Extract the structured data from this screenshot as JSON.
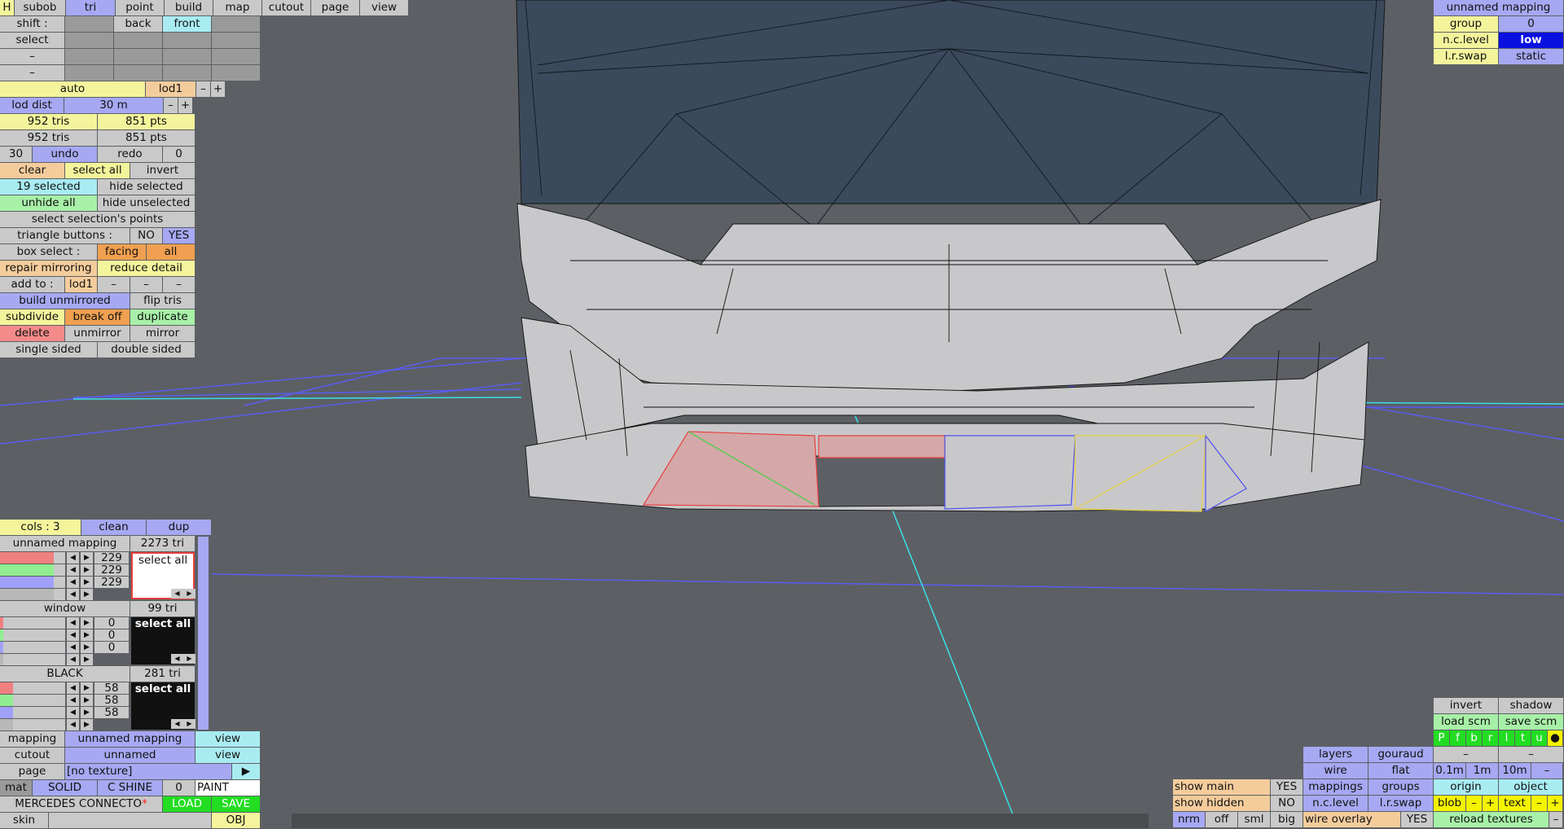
{
  "colors": {
    "bg_ground": "#5c6064",
    "bg_sky": "#5c6064",
    "grid_blue": "#5a5cf0",
    "axis_cyan": "#39e0e8",
    "glass": "#3a4a5c",
    "body": "#c8c8ca",
    "sel_red": "#e84040",
    "sel_green": "#40d040",
    "sel_yellow": "#e8d040",
    "sel_blue": "#5050f0"
  },
  "top_menu": {
    "h": "H",
    "items": [
      "subob",
      "tri",
      "point",
      "build",
      "map",
      "cutout",
      "page",
      "view"
    ]
  },
  "shift": {
    "label": "shift :",
    "back": "back",
    "front": "front"
  },
  "select": {
    "label": "select"
  },
  "dash_rows": [
    "–",
    "–"
  ],
  "auto": {
    "label": "auto",
    "lod": "lod1",
    "minus": "–",
    "plus": "+"
  },
  "lod_dist": {
    "label": "lod dist",
    "value": "30 m",
    "minus": "–",
    "plus": "+"
  },
  "counts": [
    {
      "tris": "952 tris",
      "pts": "851 pts"
    },
    {
      "tris": "952 tris",
      "pts": "851 pts"
    }
  ],
  "history": {
    "left": "30",
    "undo": "undo",
    "redo": "redo",
    "right": "0"
  },
  "selection": {
    "clear": "clear",
    "select_all": "select all",
    "invert": "invert",
    "selected": "19 selected",
    "hide_selected": "hide selected",
    "unhide_all": "unhide all",
    "hide_unselected": "hide unselected",
    "select_points": "select selection's points"
  },
  "triangle_buttons": {
    "label": "triangle buttons :",
    "no": "NO",
    "yes": "YES"
  },
  "box_select": {
    "label": "box select :",
    "facing": "facing",
    "all": "all"
  },
  "repair": {
    "repair": "repair mirroring",
    "reduce": "reduce detail"
  },
  "add_to": {
    "label": "add to :",
    "lod": "lod1",
    "d1": "–",
    "d2": "–",
    "d3": "–"
  },
  "build": {
    "unmirrored": "build unmirrored",
    "flip": "flip tris"
  },
  "ops": {
    "subdivide": "subdivide",
    "break_off": "break off",
    "duplicate": "duplicate",
    "delete": "delete",
    "unmirror": "unmirror",
    "mirror": "mirror",
    "single": "single sided",
    "double": "double sided"
  },
  "cols": {
    "label": "cols : 3",
    "clean": "clean",
    "dup": "dup"
  },
  "materials": [
    {
      "name": "unnamed mapping",
      "tri": "2273 tri",
      "values": [
        "229",
        "229",
        "229"
      ],
      "select_all": "select all",
      "levels": [
        0.83,
        0.83,
        0.83,
        0.83
      ]
    },
    {
      "name": "window",
      "tri": "99 tri",
      "values": [
        "0",
        "0",
        "0"
      ],
      "select_all": "select all",
      "levels": [
        0,
        0,
        0,
        0
      ]
    },
    {
      "name": "BLACK",
      "tri": "281 tri",
      "values": [
        "58",
        "58",
        "58"
      ],
      "select_all": "select all",
      "levels": [
        0.2,
        0.2,
        0.2,
        0.2
      ]
    }
  ],
  "bottom_left": {
    "mapping_label": "mapping",
    "mapping_value": "unnamed mapping",
    "view1": "view",
    "cutout_label": "cutout",
    "cutout_value": "unnamed",
    "view2": "view",
    "page_label": "page",
    "page_value": "[no texture]",
    "page_arrow": "▶",
    "mat": "mat",
    "solid": "SOLID",
    "cshine": "C SHINE",
    "zero": "0",
    "paint": "PAINT",
    "model": "MERCEDES CONNECTO",
    "star": "*",
    "load": "LOAD",
    "save": "SAVE",
    "skin": "skin",
    "obj": "OBJ"
  },
  "top_right": {
    "title": "unnamed mapping",
    "group": "group",
    "group_val": "0",
    "nclevel": "n.c.level",
    "nclevel_val": "low",
    "lrswap": "l.r.swap",
    "lrswap_val": "static"
  },
  "bottom_right": {
    "invert": "invert",
    "shadow": "shadow",
    "load_scm": "load scm",
    "save_scm": "save scm",
    "letters": [
      "P",
      "f",
      "b",
      "r",
      "l",
      "t",
      "u",
      "●"
    ],
    "dash1": "–",
    "dash2": "–",
    "layers": "layers",
    "gouraud": "gouraud",
    "wire": "wire",
    "flat": "flat",
    "d01": "0.1m",
    "d1": "1m",
    "d10": "10m",
    "dminus": "–",
    "show_main": "show main",
    "show_main_v": "YES",
    "mappings": "mappings",
    "groups": "groups",
    "origin": "origin",
    "object": "object",
    "show_hidden": "show hidden",
    "show_hidden_v": "NO",
    "nclevel": "n.c.level",
    "lrswap": "l.r.swap",
    "blob": "blob",
    "bm": "–",
    "bp": "+",
    "text": "text",
    "tm": "–",
    "tp": "+",
    "nrm": "nrm",
    "off": "off",
    "sml": "sml",
    "big": "big",
    "wire_overlay": "wire overlay",
    "wire_overlay_v": "YES",
    "reload": "reload textures",
    "rminus": "–"
  }
}
